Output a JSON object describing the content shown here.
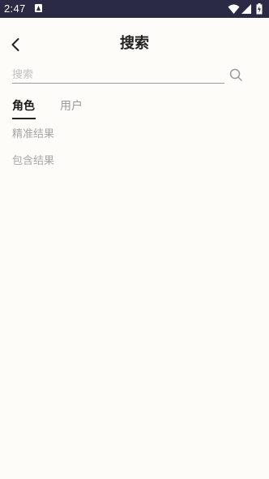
{
  "status_bar": {
    "time": "2:47",
    "background": "#2a2a45"
  },
  "header": {
    "title": "搜索",
    "back_icon": "chevron-left-icon"
  },
  "search": {
    "placeholder": "搜索",
    "value": "",
    "icon": "search-icon"
  },
  "tabs": [
    {
      "label": "角色",
      "active": true
    },
    {
      "label": "用户",
      "active": false
    }
  ],
  "results": {
    "exact_label": "精准结果",
    "contains_label": "包含结果"
  },
  "colors": {
    "page_background": "#fdfcf8",
    "active_tab": "#1a1a1a",
    "inactive_tab": "#9a9a9a",
    "secondary_text": "#a6a6a6"
  }
}
